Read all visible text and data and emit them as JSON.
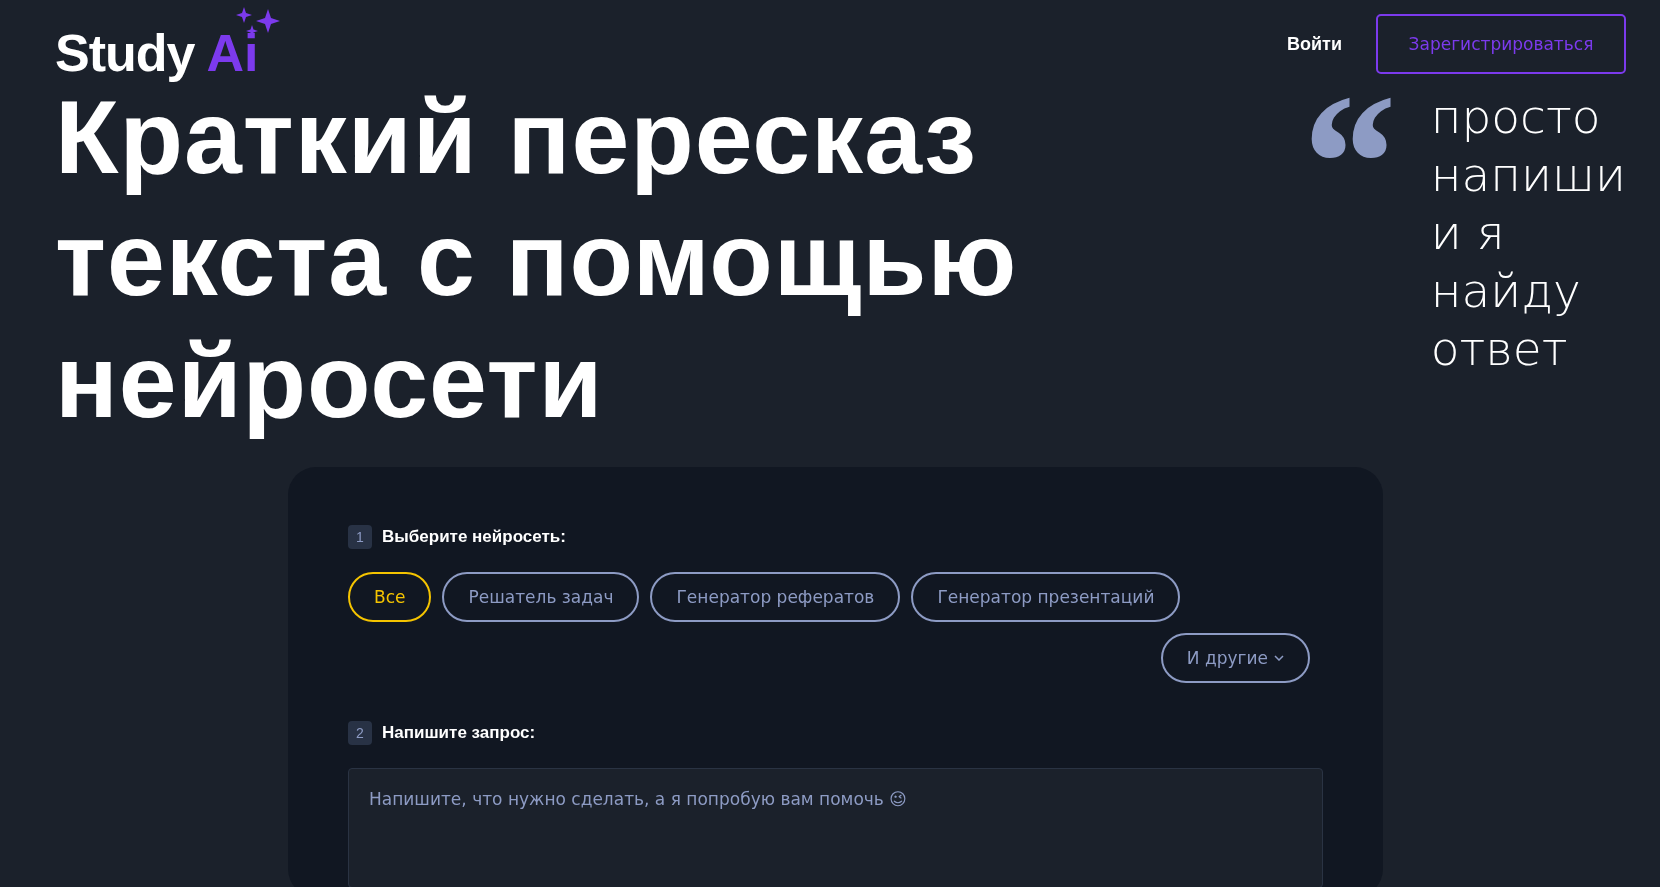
{
  "header": {
    "logo": {
      "word": "Study",
      "accent": "Ai"
    },
    "login": "Войти",
    "register": "Зарегистрироваться"
  },
  "hero": {
    "title_lines": [
      "Краткий пересказ",
      "текста с помощью",
      "нейросети"
    ],
    "quote_mark": "“",
    "quote_lines": [
      "просто",
      "напиши",
      "и я",
      "найду",
      "ответ"
    ]
  },
  "form": {
    "step_1": {
      "number": "1",
      "label": "Выберите нейросеть:"
    },
    "chips": [
      {
        "label": "Все",
        "selected": true
      },
      {
        "label": "Решатель задач",
        "selected": false
      },
      {
        "label": "Генератор рефератов",
        "selected": false
      },
      {
        "label": "Генератор презентаций",
        "selected": false
      }
    ],
    "more_button": "И другие",
    "step_2": {
      "number": "2",
      "label": "Напишите запрос:"
    },
    "request": {
      "placeholder": "Напишите, что нужно сделать, а я попробую вам помочь 😉"
    }
  }
}
